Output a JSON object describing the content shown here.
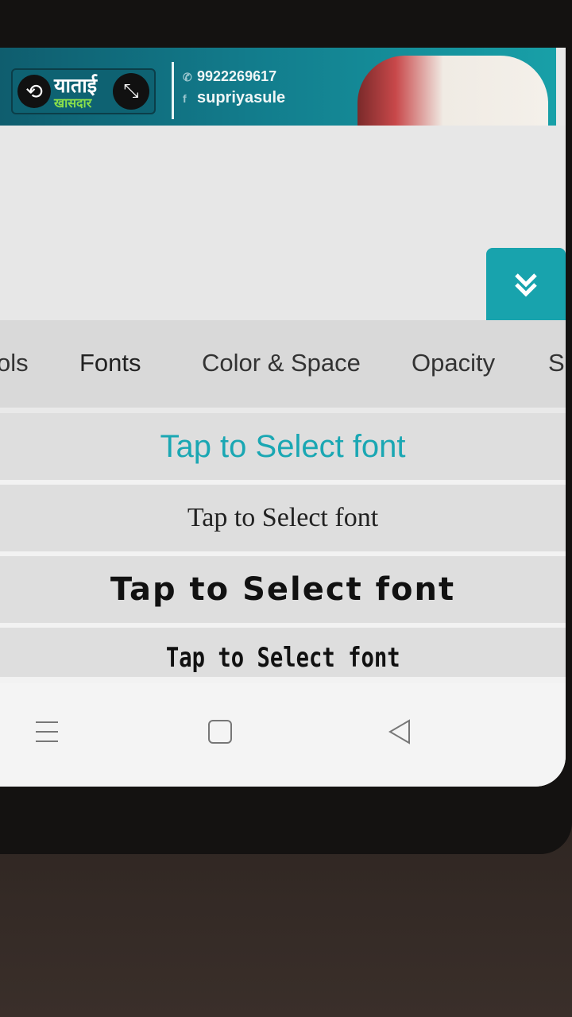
{
  "banner": {
    "logo_title": "याताई",
    "logo_subtitle": "खासदार",
    "phone": "9922269617",
    "facebook": "supriyasule",
    "colors": {
      "banner": "#127c8c",
      "accent": "#8be04a"
    }
  },
  "tabs": [
    "ols",
    "Fonts",
    "Color & Space",
    "Opacity",
    "Sl"
  ],
  "font_options": [
    "Tap to Select font",
    "Tap to Select font",
    "Tap to Select font",
    "Tap to Select font"
  ],
  "icons": {
    "collapse": "double-chevron-down-icon",
    "menu": "menu-icon",
    "home": "home-icon",
    "back": "back-icon"
  },
  "accent_color": "#18a3ad"
}
